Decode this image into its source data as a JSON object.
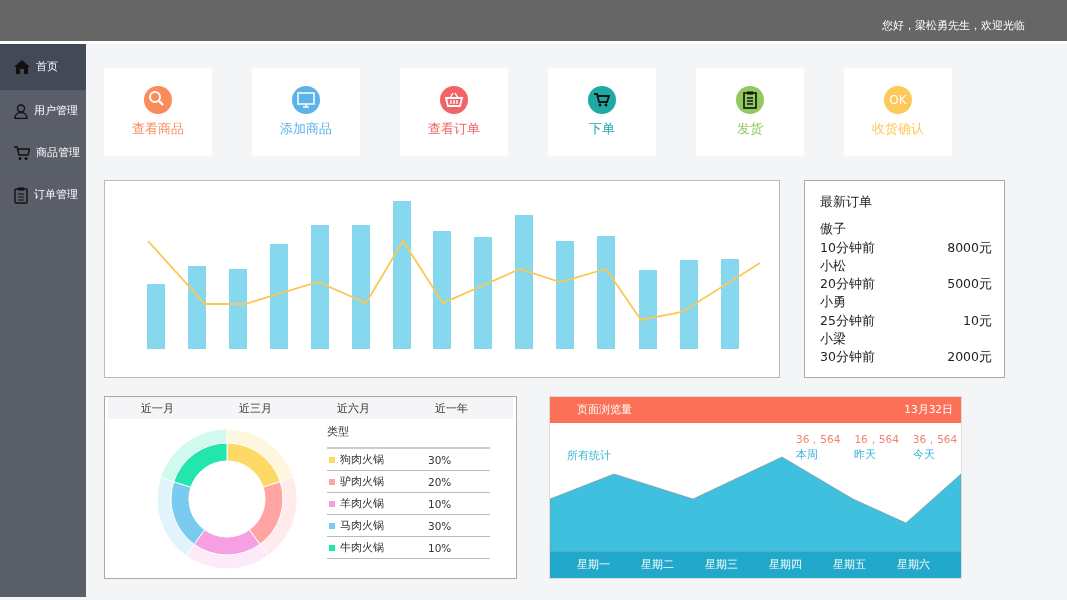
{
  "header": {
    "greeting": "您好，梁松勇先生，欢迎光临"
  },
  "sidebar": {
    "items": [
      {
        "label": "首页",
        "kind": "home",
        "selected": true
      },
      {
        "label": "用户管理",
        "kind": "user",
        "selected": false
      },
      {
        "label": "商品管理",
        "kind": "cart",
        "selected": false
      },
      {
        "label": "订单管理",
        "kind": "clipboard",
        "selected": false
      }
    ]
  },
  "tiles": [
    {
      "label": "查看商品",
      "kind": "search",
      "color": "#fc8b5c"
    },
    {
      "label": "添加商品",
      "kind": "monitor",
      "color": "#5cb3ea"
    },
    {
      "label": "查看订单",
      "kind": "basket",
      "color": "#f26466"
    },
    {
      "label": "下单",
      "kind": "cart",
      "color": "#1eaaa4"
    },
    {
      "label": "发货",
      "kind": "clipboard",
      "color": "#92c95e"
    },
    {
      "label": "收货确认",
      "kind": "ok",
      "icon_text": "OK",
      "color": "#fdc95a"
    }
  ],
  "latest_orders": {
    "title": "最新订单",
    "orders": [
      {
        "name": "傲子",
        "time": "10分钟前",
        "amount": "8000元"
      },
      {
        "name": "小松",
        "time": "20分钟前",
        "amount": "5000元"
      },
      {
        "name": "小勇",
        "time": "25分钟前",
        "amount": "10元"
      },
      {
        "name": "小梁",
        "time": "30分钟前",
        "amount": "2000元"
      }
    ]
  },
  "period_tabs": [
    {
      "label": "近一月"
    },
    {
      "label": "近三月"
    },
    {
      "label": "近六月"
    },
    {
      "label": "近一年"
    }
  ],
  "legend": {
    "title": "类型",
    "items": [
      {
        "label": "狗肉火锅",
        "value": "30%",
        "color": "#ffd966"
      },
      {
        "label": "驴肉火锅",
        "value": "20%",
        "color": "#ffa3a3"
      },
      {
        "label": "羊肉火锅",
        "value": "10%",
        "color": "#f79fe3"
      },
      {
        "label": "马肉火锅",
        "value": "30%",
        "color": "#7acbef"
      },
      {
        "label": "牛肉火锅",
        "value": "10%",
        "color": "#23e6af"
      }
    ]
  },
  "page_views": {
    "title": "页面浏览量",
    "date": "13月32日",
    "label": "所有统计",
    "stats": [
      {
        "value": "36，564",
        "label": "本周"
      },
      {
        "value": "16，564",
        "label": "昨天"
      },
      {
        "value": "36，564",
        "label": "今天"
      }
    ],
    "x_labels": [
      "星期一",
      "星期二",
      "星期三",
      "星期四",
      "星期五",
      "星期六"
    ]
  }
}
